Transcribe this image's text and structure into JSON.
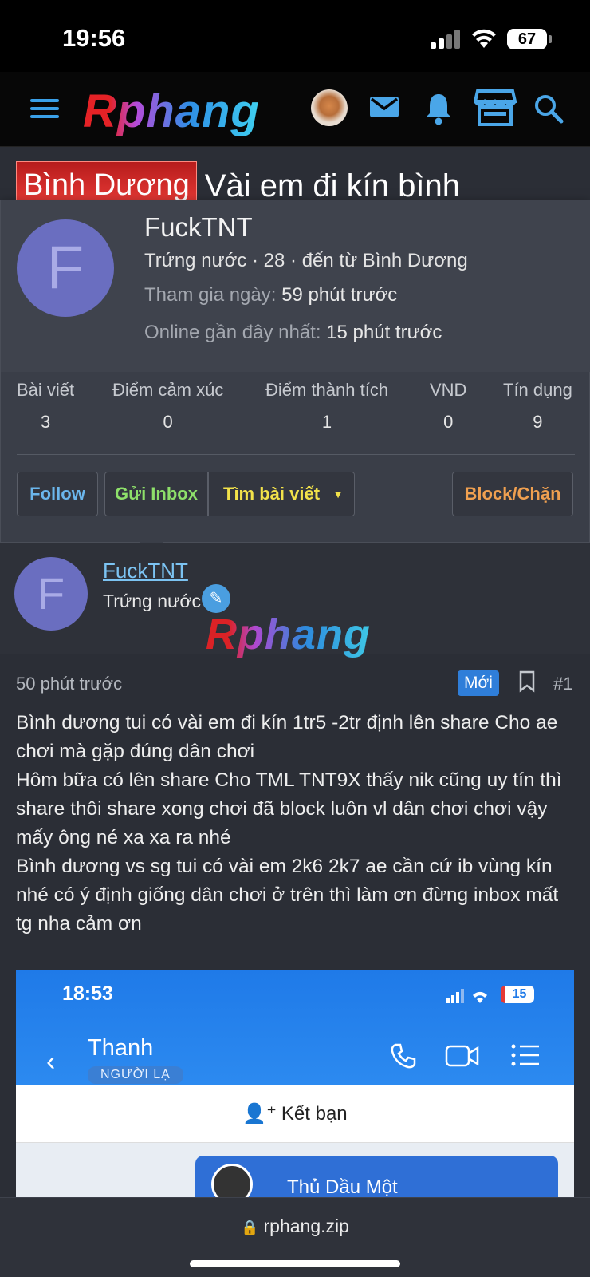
{
  "status_bar": {
    "time": "19:56",
    "battery": "67"
  },
  "nav": {
    "logo": "Rphang"
  },
  "thread": {
    "prefix": "Bình Dương",
    "title": "Vài em đi kín bình"
  },
  "profile_popup": {
    "avatar_letter": "F",
    "username": "FuckTNT",
    "meta": "Trứng nước · 28 · đến từ Bình Dương",
    "joined_label": "Tham gia ngày:",
    "joined_value": "59 phút trước",
    "online_label": "Online gần đây nhất:",
    "online_value": "15 phút trước",
    "stats": [
      {
        "label": "Bài viết",
        "value": "3"
      },
      {
        "label": "Điểm cảm xúc",
        "value": "0"
      },
      {
        "label": "Điểm thành tích",
        "value": "1"
      },
      {
        "label": "VND",
        "value": "0"
      },
      {
        "label": "Tín dụng",
        "value": "9"
      }
    ],
    "buttons": {
      "follow": "Follow",
      "inbox": "Gửi Inbox",
      "find_posts": "Tìm bài viết",
      "block": "Block/Chặn"
    },
    "colors": {
      "follow": "#6bb6ec",
      "inbox": "#8ee06a",
      "find_posts": "#f2e24a",
      "block": "#f0a050"
    }
  },
  "post": {
    "author": {
      "avatar_letter": "F",
      "name": "FuckTNT",
      "rank": "Trứng nước"
    },
    "watermark": "Rphang",
    "time": "50 phút trước",
    "badge": "Mới",
    "number": "#1",
    "body": [
      "Bình dương tui có vài em đi kín 1tr5 -2tr định lên share Cho ae chơi mà gặp đúng dân chơi",
      "Hôm bữa có lên share Cho TML TNT9X thấy nik cũng uy tín thì share thôi share xong chơi đã block luôn vl dân chơi chơi vậy mấy ông né xa xa ra nhé",
      "Bình dương vs sg tui có vài em 2k6 2k7 ae cần cứ ib vùng kín nhé có ý định giống dân chơi ở trên thì làm ơn đừng inbox mất tg nha cảm ơn"
    ],
    "attachment": {
      "time": "18:53",
      "battery": "15",
      "contact": "Thanh",
      "contact_label": "NGƯỜI LẠ",
      "add_friend": "Kết bạn",
      "bubble_text": "Thủ Dầu Một"
    }
  },
  "browser": {
    "url": "rphang.zip"
  }
}
